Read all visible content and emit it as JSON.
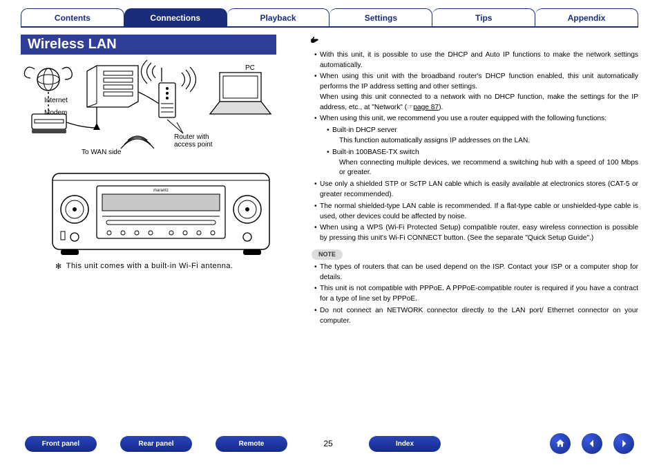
{
  "tabs": [
    "Contents",
    "Connections",
    "Playback",
    "Settings",
    "Tips",
    "Appendix"
  ],
  "active_tab_index": 1,
  "section_title": "Wireless LAN",
  "diagram": {
    "internet": "Internet",
    "modem": "Modem",
    "to_wan": "To WAN side",
    "router": "Router with\naccess point",
    "pc": "PC"
  },
  "asterisk_note": {
    "mark": "✻",
    "text": "This unit comes with a built-in Wi-Fi antenna."
  },
  "hand_icon": "👉",
  "right_bullets": [
    "With this unit, it is possible to use the DHCP and Auto IP functions to make the network settings automatically.",
    "When using this unit with the broadband router's DHCP function enabled, this unit automatically performs the IP address setting and other settings.\nWhen using this unit connected to a network with no DHCP function, make the settings for the IP address, etc., at \"Network\" (☞page 87).",
    "When using this unit, we recommend you use a router equipped with the following functions:",
    "Use only a shielded STP or ScTP LAN cable which is easily available at electronics stores (CAT-5 or greater recommended).",
    "The normal shielded-type LAN cable is recommended. If a flat-type cable or unshielded-type cable is used, other devices could be affected by noise.",
    "When using a WPS (Wi-Fi Protected Setup) compatible router, easy wireless connection is possible by pressing this unit's Wi-Fi CONNECT button. (See the separate \"Quick Setup Guide\".)"
  ],
  "sub_bullets": [
    {
      "head": "Built-in DHCP server",
      "desc": "This function automatically assigns IP addresses on the LAN."
    },
    {
      "head": "Built-in 100BASE-TX switch",
      "desc": "When connecting multiple devices, we recommend a switching hub with a speed of 100 Mbps or greater."
    }
  ],
  "page_ref": "page 87",
  "note_label": "NOTE",
  "note_bullets": [
    "The types of routers that can be used depend on the ISP. Contact your ISP or a computer shop for details.",
    "This unit is not compatible with PPPoE. A PPPoE-compatible router is required if you have a contract for a type of line set by PPPoE.",
    "Do not connect an NETWORK connector directly to the LAN port/ Ethernet connector on your computer."
  ],
  "footer": {
    "pills": [
      "Front panel",
      "Rear panel",
      "Remote",
      "Index"
    ],
    "page": "25",
    "nav_icons": [
      "home-icon",
      "prev-icon",
      "next-icon"
    ]
  }
}
